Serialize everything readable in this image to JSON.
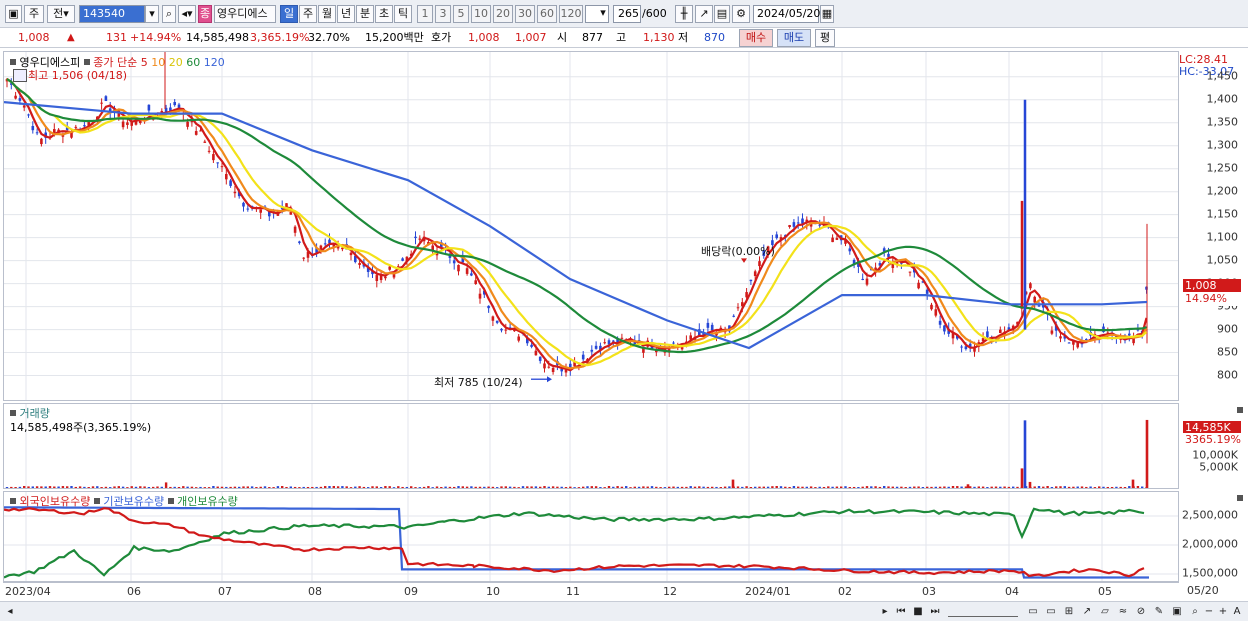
{
  "toolbar": {
    "market": "주",
    "scope": "전",
    "code": "143540",
    "pink_tag": "종",
    "stock_name": "영우디에스",
    "periods": [
      "일",
      "주",
      "월",
      "년",
      "분",
      "초",
      "틱"
    ],
    "active_period": "일",
    "intervals": [
      "1",
      "3",
      "5",
      "10",
      "20",
      "30",
      "60",
      "120"
    ],
    "count": "265",
    "count_total": "/600",
    "date": "2024/05/20"
  },
  "quote": {
    "price": "1,008",
    "arrow": "▲",
    "change": "131",
    "change_pct": "+14.94%",
    "volume": "14,585,498",
    "volume_pct": "3,365.19%",
    "turnover": "32.70%",
    "amount": "15,200백만",
    "bid_label": "호가",
    "bid1": "1,008",
    "bid2": "1,007",
    "open_label": "시",
    "open": "877",
    "high_label": "고",
    "high": "1,130",
    "low_label": "저",
    "low": "870",
    "buy": "매수",
    "sell": "매도",
    "eval": "평"
  },
  "price_panel": {
    "legend_name": "영우디에스피",
    "legend_type": "종가 단순",
    "ma_periods": [
      "5",
      "10",
      "20",
      "60",
      "120"
    ],
    "ma_colors": [
      "#d11a1a",
      "#f08a1c",
      "#f3e21a",
      "#1e8a3a",
      "#3a64d8"
    ],
    "high_note": "최고 1,506 (04/18)",
    "low_note": "최저 785 (10/24)",
    "dividend_note": "배당락(0.00%)",
    "lc": "LC:28.41",
    "hc": "HC:-33.07",
    "last_price_tag": "1,008",
    "last_pct_tag": "14.94%",
    "yticks": [
      "1,450",
      "1,400",
      "1,350",
      "1,300",
      "1,250",
      "1,200",
      "1,150",
      "1,100",
      "1,050",
      "1,000",
      "950",
      "900",
      "850",
      "800"
    ]
  },
  "volume_panel": {
    "title": "거래량",
    "value": "14,585,498주(3,365.19%)",
    "tag_value": "14,585K",
    "tag_pct": "3365.19%",
    "yticks": [
      "10,000K",
      "5,000K"
    ]
  },
  "holding_panel": {
    "legend": [
      "외국인보유수량",
      "기관보유수량",
      "개인보유수량"
    ],
    "colors": [
      "#d11a1a",
      "#3a64d8",
      "#1e8a3a"
    ],
    "yticks": [
      "2,500,000",
      "2,000,000",
      "1,500,000"
    ]
  },
  "xaxis": [
    "2023/04",
    "06",
    "07",
    "08",
    "09",
    "10",
    "11",
    "12",
    "2024/01",
    "02",
    "03",
    "04",
    "05",
    "05/20"
  ],
  "chart_data": {
    "type": "line",
    "title": "영우디에스피",
    "x": [
      "2023/04",
      "2023/06",
      "2023/07",
      "2023/08",
      "2023/09",
      "2023/10",
      "2023/11",
      "2023/12",
      "2024/01",
      "2024/02",
      "2024/03",
      "2024/04",
      "2024/05",
      "2024/05/20"
    ],
    "series": [
      {
        "name": "종가",
        "values": [
          1450,
          1350,
          1370,
          1100,
          1040,
          900,
          800,
          850,
          900,
          1110,
          960,
          880,
          900,
          1008
        ]
      },
      {
        "name": "120",
        "values": [
          1395,
          1370,
          1370,
          1290,
          1225,
          1125,
          1010,
          920,
          860,
          975,
          975,
          955,
          955,
          960
        ]
      }
    ],
    "ylim": [
      760,
      1500
    ],
    "volume_last": 14585498,
    "holding_ylim": [
      1400000,
      2700000
    ]
  }
}
